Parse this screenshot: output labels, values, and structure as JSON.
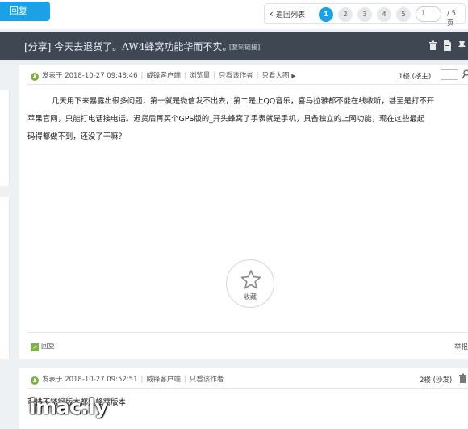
{
  "topbar": {
    "reply_label": "回复",
    "back_label": "返回列表",
    "pages": [
      "1",
      "2",
      "3",
      "4",
      "5"
    ],
    "current_page": "1",
    "page_input": "1",
    "page_total": "/ 5 页"
  },
  "thread": {
    "title": "[分享] 今天去退货了。AW4蜂窝功能华而不实。",
    "copy_link": "[复制链接]"
  },
  "post1": {
    "posted_at": "发表于 2018-10-27 09:48:46",
    "client": "威锋客户端",
    "views": "浏览量",
    "only_author": "只看该作者",
    "big_image": "只看大图",
    "floor": "1楼 (楼主)",
    "content": [
      "几天用下来暴露出很多问题，第一就是微信发不出去，第二是上QQ音乐，喜马拉雅都不能在线收听，甚至是打不开",
      "苹果官网，只能打电话接电话。退货后再买个GPS版的_开头蜂窝了手表就是手机，具备独立的上网功能，现在这些最起",
      "码得都做不到，还没了干嘛？"
    ],
    "favorite": "收藏",
    "reply": "回复",
    "report": "举报"
  },
  "post2": {
    "posted_at": "发表于 2018-10-27 09:52:51",
    "client": "威锋客户端",
    "only_author": "只看该作者",
    "floor": "2楼 (沙发)",
    "content": "可惜不锈钢版本都是蜂窝版本"
  },
  "watermark": "imac.ly"
}
